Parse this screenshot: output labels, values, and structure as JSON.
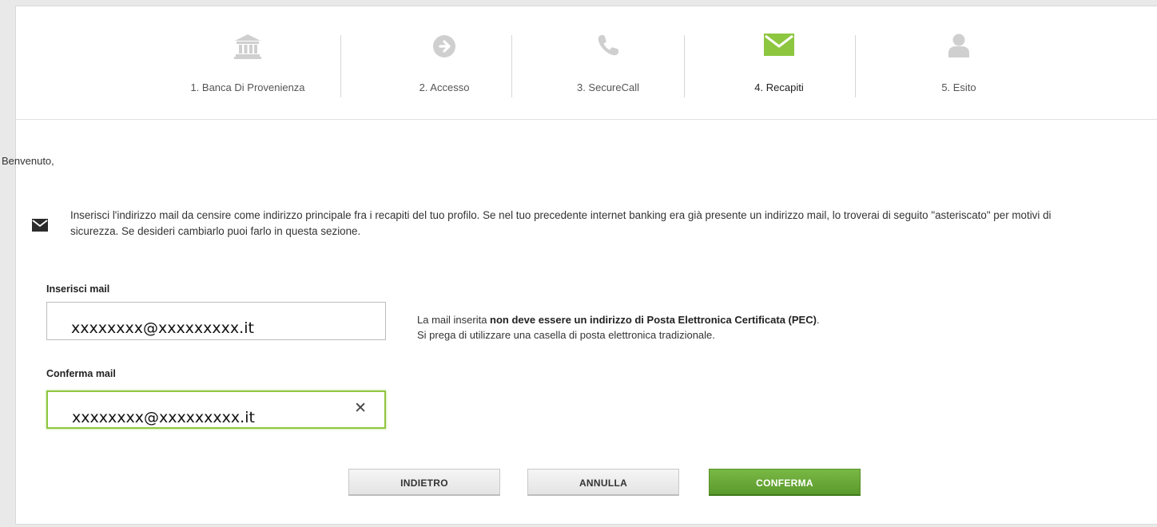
{
  "stepper": {
    "steps": [
      {
        "label": "1. Banca Di Provenienza",
        "icon": "bank-icon"
      },
      {
        "label": "2. Accesso",
        "icon": "arrow-circle-icon"
      },
      {
        "label": "3. SecureCall",
        "icon": "phone-icon"
      },
      {
        "label": "4. Recapiti",
        "icon": "envelope-icon"
      },
      {
        "label": "5. Esito",
        "icon": "user-icon"
      }
    ],
    "active_index": 3,
    "active_color": "#8dc63f",
    "inactive_color": "#cfcfcf"
  },
  "welcome": "Benvenuto, ",
  "info": {
    "icon": "envelope-icon",
    "text": "Inserisci l'indirizzo mail da censire come indirizzo principale fra i recapiti del tuo profilo. Se nel tuo precedente internet banking era già presente un indirizzo mail, lo troverai di seguito \"asteriscato\" per motivi di sicurezza. Se desideri cambiarlo puoi farlo in questa sezione."
  },
  "form": {
    "email_label": "Inserisci mail",
    "email_value": "xxxxxxxx@xxxxxxxxx.it",
    "confirm_label": "Conferma mail",
    "confirm_value": "xxxxxxxx@xxxxxxxxx.it",
    "clear_icon": "close-icon"
  },
  "note": {
    "prefix": "La mail inserita ",
    "bold": "non deve essere un indirizzo di Posta Elettronica Certificata (PEC)",
    "suffix": ".",
    "line2": "Si prega di utilizzare una casella di posta elettronica tradizionale."
  },
  "buttons": {
    "back": "INDIETRO",
    "cancel": "ANNULLA",
    "confirm": "CONFERMA"
  }
}
